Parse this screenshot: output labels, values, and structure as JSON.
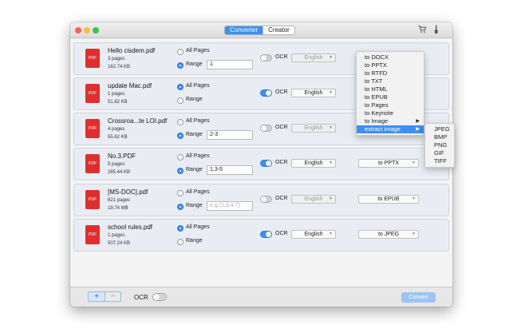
{
  "toolbar": {
    "tabs": [
      {
        "label": "Converter",
        "active": true
      },
      {
        "label": "Creator",
        "active": false
      }
    ],
    "cart_icon": "cart-icon",
    "brush_icon": "brush-icon"
  },
  "labels": {
    "all_pages": "All Pages",
    "range": "Range",
    "ocr": "OCR",
    "pdf_badge": "PDF"
  },
  "files": [
    {
      "name": "Hello cisdem.pdf",
      "pages": "3 pages",
      "size": "162.74 KB",
      "all_pages": false,
      "range_value": "1",
      "range_placeholder": "",
      "ocr": false,
      "language": "English",
      "format": ""
    },
    {
      "name": "update Mac.pdf",
      "pages": "1 pages",
      "size": "51.82 KB",
      "all_pages": true,
      "range_value": "",
      "range_placeholder": "",
      "ocr": true,
      "language": "English",
      "format": ""
    },
    {
      "name": "Crossroa...te LOI.pdf",
      "pages": "4 pages",
      "size": "55.62 KB",
      "all_pages": false,
      "range_value": "2-3",
      "range_placeholder": "",
      "ocr": false,
      "language": "English",
      "format": ""
    },
    {
      "name": "No.3.PDF",
      "pages": "5 pages",
      "size": "285.44 KB",
      "all_pages": false,
      "range_value": "1,3-5",
      "range_placeholder": "",
      "ocr": true,
      "language": "English",
      "format": "to PPTX"
    },
    {
      "name": "[MS-DOC].pdf",
      "pages": "621 pages",
      "size": "19.74 MB",
      "all_pages": false,
      "range_value": "",
      "range_placeholder": "e.g.(1,3,4-7)",
      "ocr": false,
      "language": "English",
      "format": "to EPUB"
    },
    {
      "name": "school rules.pdf",
      "pages": "1 pages",
      "size": "507.24 KB",
      "all_pages": true,
      "range_value": "",
      "range_placeholder": "",
      "ocr": true,
      "language": "English",
      "format": "to JPEG"
    }
  ],
  "format_menu": {
    "items": [
      "to DOCX",
      "to PPTX",
      "to RTFD",
      "to TXT",
      "to HTML",
      "to EPUB",
      "to Pages",
      "to Keynote",
      "to Image",
      "extract image"
    ],
    "selected": "extract image",
    "submenu": [
      "JPEG",
      "BMP",
      "PNG",
      "GIF",
      "TIFF"
    ]
  },
  "bottom": {
    "add_label": "+",
    "remove_label": "−",
    "ocr_label": "OCR",
    "ocr_enabled": false,
    "convert_label": "Convert"
  },
  "colors": {
    "accent": "#3d8ff5",
    "pdf_red": "#e02e2e",
    "row_bg": "#e9edf3"
  }
}
